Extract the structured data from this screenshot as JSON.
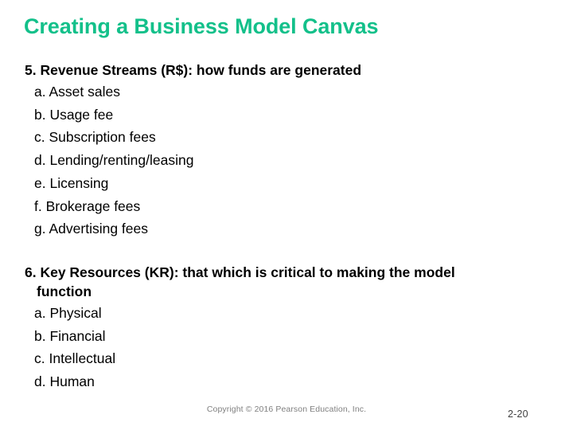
{
  "slide": {
    "title": "Creating a Business Model Canvas",
    "title_color": "#13c08a",
    "background_color": "#ffffff",
    "text_color": "#000000"
  },
  "sections": [
    {
      "heading": "5. Revenue Streams (R$): how funds are generated",
      "items": [
        "a. Asset sales",
        "b. Usage fee",
        "c. Subscription fees",
        "d. Lending/renting/leasing",
        "e. Licensing",
        "f. Brokerage fees",
        "g. Advertising fees"
      ]
    },
    {
      "heading": "6. Key Resources (KR): that which is critical to making the model function",
      "items": [
        "a. Physical",
        "b. Financial",
        "c. Intellectual",
        "d. Human"
      ]
    }
  ],
  "footer": {
    "copyright": "Copyright © 2016 Pearson Education, Inc.",
    "copyright_color": "#808080",
    "page_number": "2-20"
  }
}
